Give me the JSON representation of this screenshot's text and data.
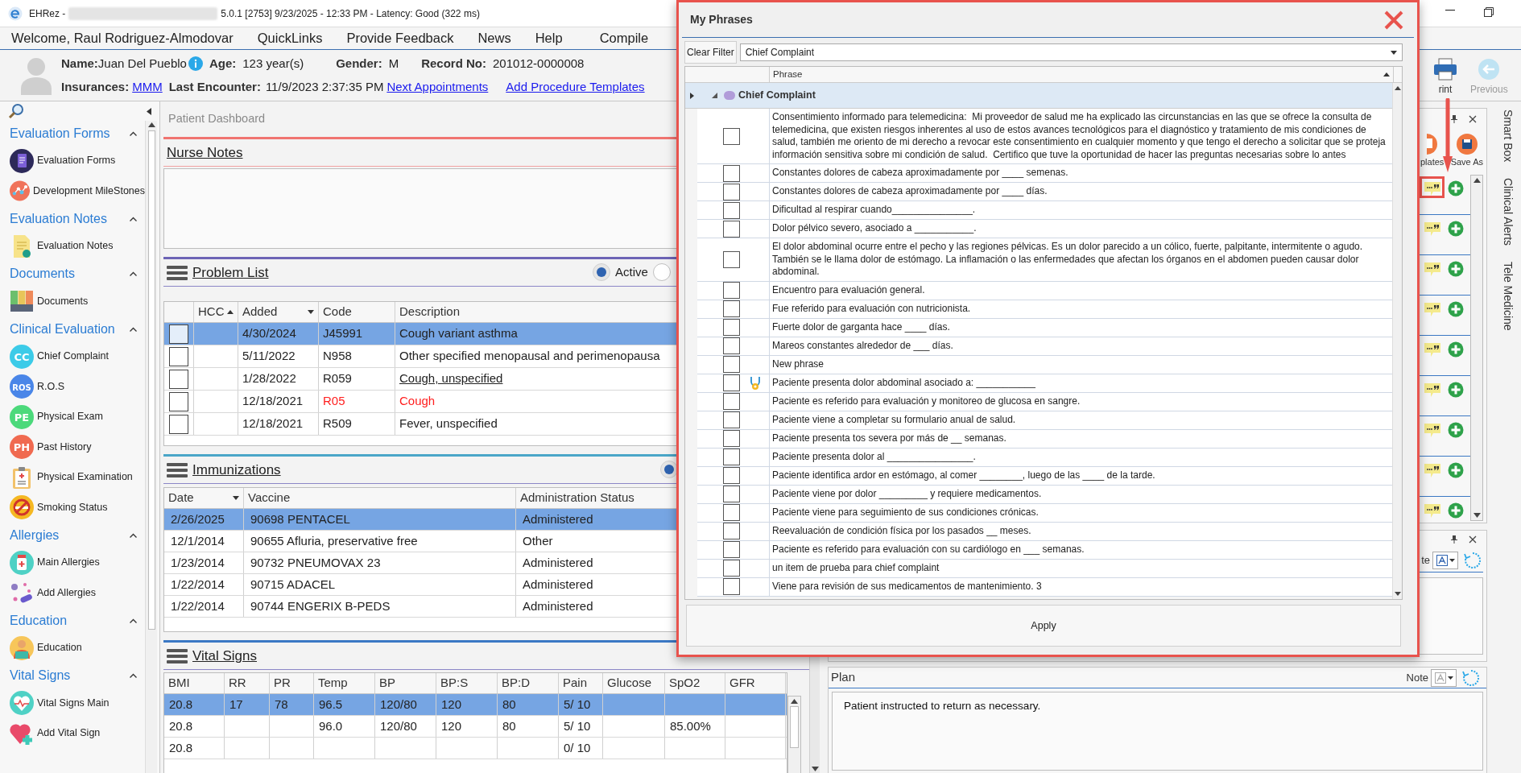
{
  "title_bar": {
    "app": "EHRez - ",
    "info": "5.0.1 [2753] 9/23/2025 - 12:33 PM - Latency: Good (322 ms)"
  },
  "menu": [
    "Welcome, Raul Rodriguez-Almodovar",
    "QuickLinks",
    "Provide Feedback",
    "News",
    "Help",
    "Compile"
  ],
  "patient": {
    "name_label": "Name:",
    "name": "Juan Del Pueblo",
    "age_label": "Age:",
    "age": "123 year(s)",
    "gender_label": "Gender:",
    "gender": "M",
    "record_label": "Record No:",
    "record": "201012-0000008",
    "insurances_label": "Insurances:",
    "insurance": "MMM",
    "last_encounter_label": "Last Encounter:",
    "last_encounter": "11/9/2023 2:37:35 PM",
    "links": [
      "Next Appointments",
      "Add Procedure Templates"
    ]
  },
  "toolbar": [
    {
      "kind": "print",
      "label": "rint",
      "disabled": false
    },
    {
      "kind": "previous",
      "label": "Previous",
      "disabled": true
    }
  ],
  "sidebar": [
    {
      "title": "Evaluation Forms",
      "items": [
        {
          "label": "Evaluation Forms",
          "kind": "forms"
        },
        {
          "label": "Development MileStones",
          "kind": "milestones"
        }
      ]
    },
    {
      "title": "Evaluation Notes",
      "items": [
        {
          "label": "Evaluation Notes",
          "kind": "notes"
        }
      ]
    },
    {
      "title": "Documents",
      "items": [
        {
          "label": "Documents",
          "kind": "documents"
        }
      ]
    },
    {
      "title": "Clinical Evaluation",
      "items": [
        {
          "label": "Chief Complaint",
          "kind": "badge",
          "badge": "CC",
          "color": "#3ccbe8"
        },
        {
          "label": "R.O.S",
          "kind": "badge",
          "badge": "ROS",
          "color": "#4a86e8"
        },
        {
          "label": "Physical Exam",
          "kind": "badge",
          "badge": "PE",
          "color": "#4cd97b"
        },
        {
          "label": "Past History",
          "kind": "badge",
          "badge": "PH",
          "color": "#f06a50"
        },
        {
          "label": "Physical Examination",
          "kind": "clipboard"
        },
        {
          "label": "Smoking Status",
          "kind": "smoking"
        }
      ]
    },
    {
      "title": "Allergies",
      "items": [
        {
          "label": "Main Allergies",
          "kind": "bottle"
        },
        {
          "label": "Add Allergies",
          "kind": "pills"
        }
      ]
    },
    {
      "title": "Education",
      "items": [
        {
          "label": "Education",
          "kind": "reader"
        }
      ]
    },
    {
      "title": "Vital Signs",
      "items": [
        {
          "label": "Vital Signs Main",
          "kind": "heart"
        },
        {
          "label": "Add Vital Sign",
          "kind": "heartplus"
        }
      ]
    }
  ],
  "dashboard": {
    "tab_title": "Patient Dashboard",
    "nurse_notes": {
      "title": "Nurse Notes"
    },
    "problem_list": {
      "title": "Problem List",
      "filters": [
        {
          "label": "Active",
          "selected": true
        },
        {
          "selected": false
        }
      ],
      "columns": [
        {
          "label": "HCC",
          "sort_ascending": true
        },
        {
          "label": "Added",
          "sort_ascending": false
        },
        {
          "label": "Code"
        },
        {
          "label": "Description"
        }
      ],
      "rows": [
        {
          "selected": true,
          "kind": "normal",
          "cells": [
            "",
            "4/30/2024",
            "J45991",
            "Cough variant asthma"
          ]
        },
        {
          "selected": false,
          "kind": "normal",
          "cells": [
            "",
            "5/11/2022",
            "N958",
            "Other specified menopausal and perimenopausa"
          ]
        },
        {
          "selected": false,
          "kind": "link",
          "cells": [
            "",
            "1/28/2022",
            "R059",
            "Cough, unspecified"
          ]
        },
        {
          "selected": false,
          "kind": "alert",
          "cells": [
            "",
            "12/18/2021",
            "R05",
            "Cough"
          ]
        },
        {
          "selected": false,
          "kind": "normal",
          "cells": [
            "",
            "12/18/2021",
            "R509",
            "Fever, unspecified"
          ]
        }
      ]
    },
    "immunizations": {
      "title": "Immunizations",
      "filters": [
        {
          "selected": true
        }
      ],
      "columns": [
        {
          "label": "Date",
          "sort_ascending": false
        },
        {
          "label": "Vaccine"
        },
        {
          "label": "Administration Status"
        }
      ],
      "rows": [
        {
          "selected": true,
          "cells": [
            "2/26/2025",
            "90698 PENTACEL",
            "Administered"
          ]
        },
        {
          "selected": false,
          "cells": [
            "12/1/2014",
            "90655 Afluria, preservative free",
            "Other"
          ]
        },
        {
          "selected": false,
          "cells": [
            "1/23/2014",
            "90732 PNEUMOVAX 23",
            "Administered"
          ]
        },
        {
          "selected": false,
          "cells": [
            "1/22/2014",
            "90715 ADACEL",
            "Administered"
          ]
        },
        {
          "selected": false,
          "cells": [
            "1/22/2014",
            "90744 ENGERIX B-PEDS",
            "Administered"
          ]
        }
      ]
    },
    "vital_signs": {
      "title": "Vital Signs",
      "columns": [
        "BMI",
        "RR",
        "PR",
        "Temp",
        "BP",
        "BP:S",
        "BP:D",
        "Pain",
        "Glucose",
        "SpO2",
        "GFR"
      ],
      "rows": [
        {
          "selected": true,
          "cells": [
            "20.8",
            "17",
            "78",
            "96.5",
            "120/80",
            "120",
            "80",
            "5/ 10",
            "",
            "",
            ""
          ]
        },
        {
          "selected": false,
          "cells": [
            "20.8",
            "",
            "",
            "96.0",
            "120/80",
            "120",
            "80",
            "5/ 10",
            "",
            "85.00%",
            ""
          ]
        },
        {
          "selected": false,
          "cells": [
            "20.8",
            "",
            "",
            "",
            "",
            "",
            "",
            "0/ 10",
            "",
            "",
            ""
          ]
        }
      ]
    }
  },
  "side_panel": {
    "buttons": [
      {
        "kind": "templates",
        "label": "plates"
      },
      {
        "kind": "save",
        "label": "Save As"
      }
    ],
    "rows": [
      {
        "highlighted": true
      },
      {
        "highlighted": false
      },
      {
        "highlighted": false
      },
      {
        "highlighted": false
      },
      {
        "highlighted": false
      },
      {
        "highlighted": false
      },
      {
        "highlighted": false
      },
      {
        "highlighted": false
      },
      {
        "highlighted": false
      }
    ]
  },
  "notes_panel": {
    "note_label": "te"
  },
  "plan": {
    "title": "Plan",
    "note_label": "Note",
    "text": "Patient instructed to return as necessary."
  },
  "vertical_tabs": [
    "Smart Box",
    "Clinical Alerts",
    "Tele Medicine"
  ],
  "dialog": {
    "title": "My Phrases",
    "clear_filter": "Clear Filter",
    "filter": "Chief Complaint",
    "column": "Phrase",
    "group": "Chief Complaint",
    "apply": "Apply",
    "phrases": [
      {
        "checked": false,
        "icon": false,
        "text": "Consentimiento informado para telemedicina:  Mi proveedor de salud me ha explicado las circunstancias en las que se ofrece la consulta de telemedicina, que existen riesgos inherentes al uso de estos avances tecnológicos para el diagnóstico y tratamiento de mis condiciones de salud, también me oriento de mi derecho a revocar este consentimiento en cualquier momento y que tengo el derecho a solicitar que se proteja información sensitiva sobre mi condición de salud.  Certifico que tuve la oportunidad de hacer las preguntas necesarias sobre lo antes"
      },
      {
        "checked": false,
        "icon": false,
        "text": "Constantes dolores de cabeza aproximadamente por ____ semenas."
      },
      {
        "checked": false,
        "icon": false,
        "text": "Constantes dolores de cabeza aproximadamente por ____ días."
      },
      {
        "checked": false,
        "icon": false,
        "text": "Dificultad al respirar cuando_______________."
      },
      {
        "checked": false,
        "icon": false,
        "text": "Dolor pélvico severo, asociado a ___________."
      },
      {
        "checked": false,
        "icon": false,
        "text": "El dolor abdominal ocurre entre el pecho y las regiones pélvicas. Es un dolor parecido a un cólico, fuerte, palpitante, intermitente o agudo. También se le llama dolor de estómago. La inflamación o las enfermedades que afectan los órganos en el abdomen pueden causar dolor abdominal."
      },
      {
        "checked": false,
        "icon": false,
        "text": "Encuentro para evaluación general."
      },
      {
        "checked": false,
        "icon": false,
        "text": "Fue referido para evaluación con nutricionista."
      },
      {
        "checked": false,
        "icon": false,
        "text": "Fuerte dolor de garganta hace ____ días."
      },
      {
        "checked": false,
        "icon": false,
        "text": "Mareos constantes alrededor de ___ días."
      },
      {
        "checked": false,
        "icon": false,
        "text": "New phrase"
      },
      {
        "checked": false,
        "icon": true,
        "text": "Paciente presenta dolor abdominal asociado a: ___________"
      },
      {
        "checked": false,
        "icon": false,
        "text": "Paciente es referido para evaluación y monitoreo de glucosa en sangre."
      },
      {
        "checked": false,
        "icon": false,
        "text": "Paciente viene a completar su formulario anual de salud."
      },
      {
        "checked": false,
        "icon": false,
        "text": "Paciente presenta tos severa por más de __ semanas."
      },
      {
        "checked": false,
        "icon": false,
        "text": "Paciente presenta dolor al ________________."
      },
      {
        "checked": false,
        "icon": false,
        "text": "Paciente identifica ardor en estómago, al comer ________, luego de las ____ de la tarde."
      },
      {
        "checked": false,
        "icon": false,
        "text": "Paciente viene por dolor _________ y requiere medicamentos."
      },
      {
        "checked": false,
        "icon": false,
        "text": "Paciente viene para seguimiento de sus condiciones crónicas."
      },
      {
        "checked": false,
        "icon": false,
        "text": "Reevaluación de condición física por los pasados __ meses."
      },
      {
        "checked": false,
        "icon": false,
        "text": "Paciente es referido para evaluación con su cardiólogo en ___ semanas."
      },
      {
        "checked": false,
        "icon": false,
        "text": "un item de prueba para chief complaint"
      },
      {
        "checked": false,
        "icon": false,
        "text": "Viene para revisión de sus medicamentos de mantenimiento. 3"
      }
    ]
  }
}
